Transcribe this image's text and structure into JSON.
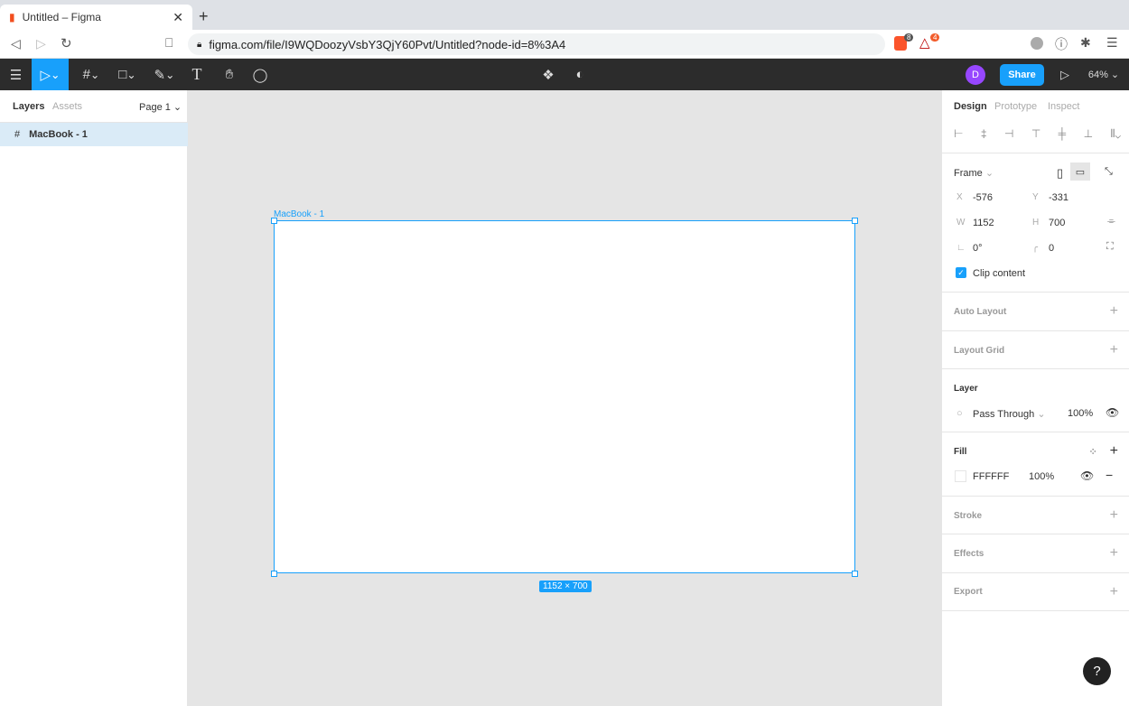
{
  "browser": {
    "tab_title": "Untitled – Figma",
    "url": "figma.com/file/I9WQDoozyVsbY3QjY60Pvt/Untitled?node-id=8%3A4",
    "brave_badge": "8",
    "rewards_badge": "4"
  },
  "toolbar": {
    "avatar_initial": "D",
    "share_label": "Share",
    "zoom": "64%"
  },
  "left_panel": {
    "tabs": [
      "Layers",
      "Assets"
    ],
    "page": "Page 1",
    "layers": [
      {
        "name": "MacBook - 1"
      }
    ]
  },
  "canvas": {
    "frame_label": "MacBook - 1",
    "size_badge": "1152 × 700"
  },
  "right_panel": {
    "tabs": [
      "Design",
      "Prototype",
      "Inspect"
    ],
    "frame_label": "Frame",
    "x_label": "X",
    "x": "-576",
    "y_label": "Y",
    "y": "-331",
    "w_label": "W",
    "w": "1152",
    "h_label": "H",
    "h": "700",
    "rotation": "0°",
    "radius": "0",
    "clip_content": "Clip content",
    "auto_layout": "Auto Layout",
    "layout_grid": "Layout Grid",
    "layer": "Layer",
    "blend": "Pass Through",
    "layer_opacity": "100%",
    "fill": "Fill",
    "fill_hex": "FFFFFF",
    "fill_opacity": "100%",
    "stroke": "Stroke",
    "effects": "Effects",
    "export": "Export"
  },
  "help": "?",
  "colors": {
    "accent": "#18a0fb",
    "toolbar": "#2c2c2c",
    "avatar": "#9747ff"
  }
}
